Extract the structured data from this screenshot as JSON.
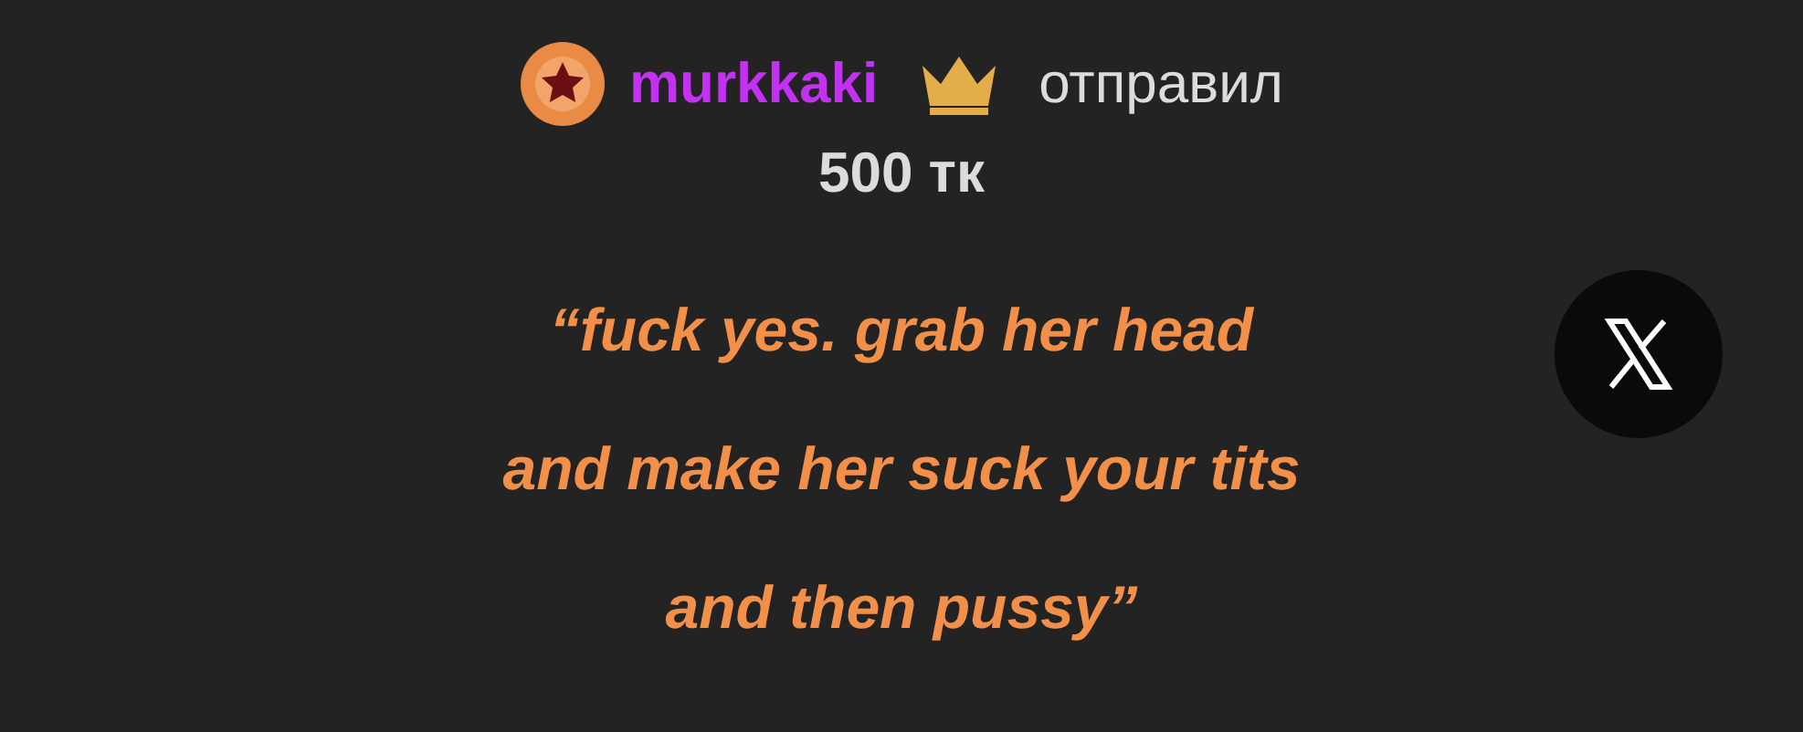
{
  "sender": {
    "username": "murkkaki",
    "action": "отправил"
  },
  "amount": "500 тк",
  "message": "“fuck yes. grab her head\nand make her suck your tits\nand then pussy”"
}
